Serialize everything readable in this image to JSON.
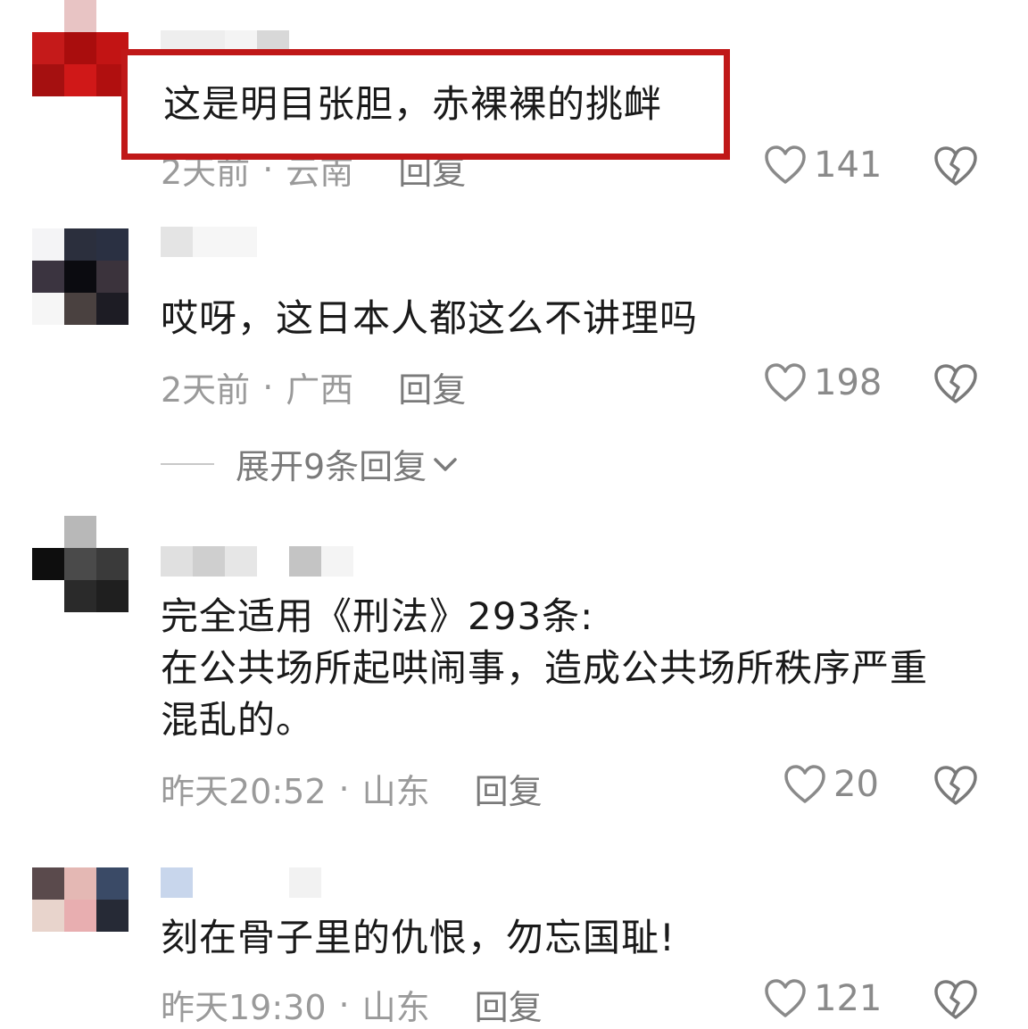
{
  "comments": [
    {
      "text": "这是明目张胆，赤裸裸的挑衅",
      "time": "2天前",
      "location": "云南",
      "reply_label": "回复",
      "likes": "141"
    },
    {
      "text": "哎呀，这日本人都这么不讲理吗",
      "time": "2天前",
      "location": "广西",
      "reply_label": "回复",
      "likes": "198",
      "expand_label": "展开9条回复"
    },
    {
      "text_lines": [
        "完全适用《刑法》293条:",
        "在公共场所起哄闹事，造成公共场所秩序严重",
        "混乱的。"
      ],
      "time": "昨天20:52",
      "location": "山东",
      "reply_label": "回复",
      "likes": "20"
    },
    {
      "text": "刻在骨子里的仇恨，勿忘国耻!",
      "time": "昨天19:30",
      "location": "山东",
      "reply_label": "回复",
      "likes": "121"
    }
  ],
  "separator": "·",
  "highlight_color": "#c01818",
  "icons": {
    "like": "heart-outline-icon",
    "dislike": "broken-heart-icon",
    "expand": "chevron-down-icon"
  }
}
